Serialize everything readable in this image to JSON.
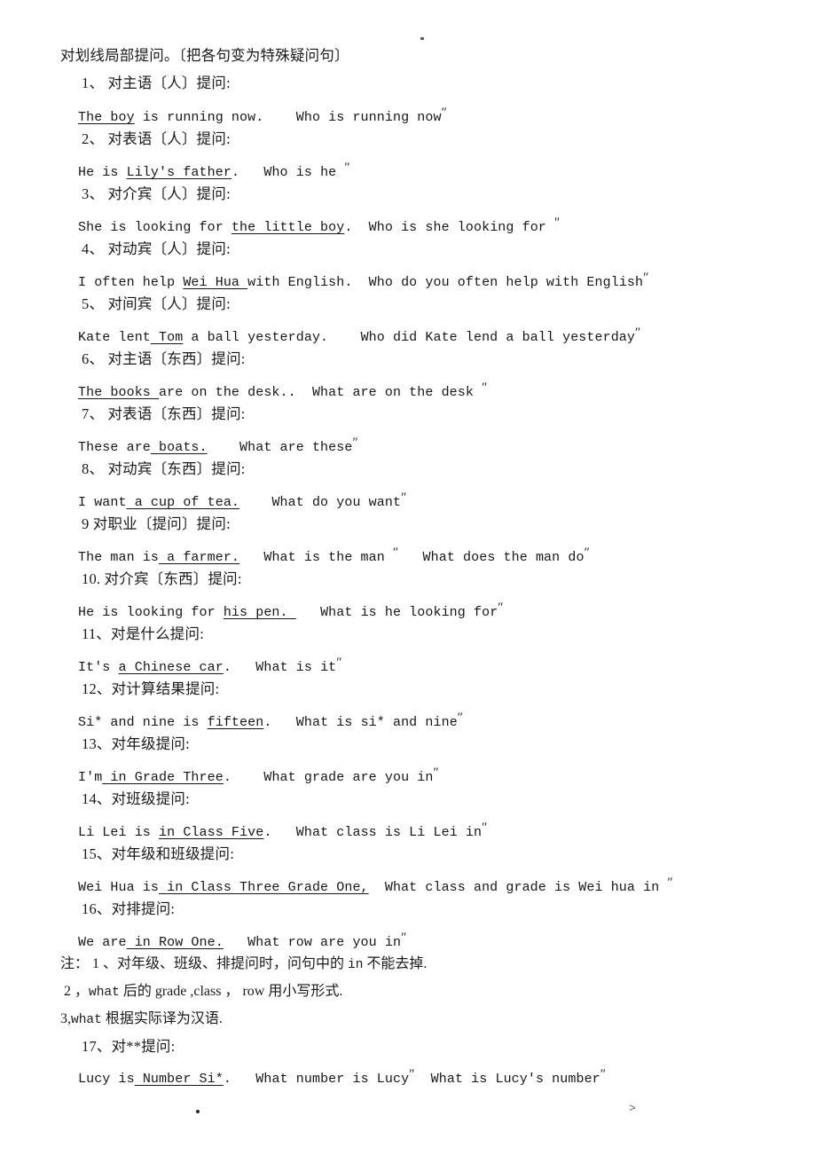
{
  "document": {
    "title": "对划线局部提问。〔把各句变为特殊疑问句〕",
    "page_marks": {
      "header_mark": "·",
      "footer_dot": "·",
      "footer_glyph": ">"
    }
  },
  "heading": {
    "text": "对划线局部提问。〔把各句变为特殊疑问句〕"
  },
  "items": [
    {
      "number": "1、",
      "label": "1、 对主语〔人〕提问:",
      "statement_pre": "",
      "statement_underlined": "The boy",
      "statement_post": " is running now.",
      "spacer": "    ",
      "question": "Who is running now",
      "qmark": "″"
    },
    {
      "number": "2、",
      "label": "2、 对表语〔人〕提问:",
      "statement_pre": "He is ",
      "statement_underlined": "Lily's father",
      "statement_post": ".",
      "spacer": "   ",
      "question": "Who is he ",
      "qmark": "″"
    },
    {
      "number": "3、",
      "label": "3、 对介宾〔人〕提问:",
      "statement_pre": "She is looking for ",
      "statement_underlined": "the little boy",
      "statement_post": ".",
      "spacer": "  ",
      "question": "Who is she looking for ",
      "qmark": "″"
    },
    {
      "number": "4、",
      "label": "4、 对动宾〔人〕提问:",
      "statement_pre": "I often help ",
      "statement_underlined": "Wei Hua ",
      "statement_post": "with English.",
      "spacer": "  ",
      "question": "Who do you often help with English",
      "qmark": "″"
    },
    {
      "number": "5、",
      "label": "5、 对间宾〔人〕提问:",
      "statement_pre": "Kate lent",
      "statement_underlined": " Tom",
      "statement_post": " a ball yesterday.",
      "spacer": "    ",
      "question": "Who did Kate lend a ball yesterday",
      "qmark": "″"
    },
    {
      "number": "6、",
      "label": "6、 对主语〔东西〕提问:",
      "statement_pre": "",
      "statement_underlined": "The books ",
      "statement_post": "are on the desk..",
      "spacer": "  ",
      "question": "What are on the desk ",
      "qmark": "″"
    },
    {
      "number": "7、",
      "label": "7、 对表语〔东西〕提问:",
      "statement_pre": "These are",
      "statement_underlined": " boats.",
      "statement_post": "",
      "spacer": "    ",
      "question": "What are these",
      "qmark": "″"
    },
    {
      "number": "8、",
      "label": "8、 对动宾〔东西〕提问:",
      "statement_pre": "I want",
      "statement_underlined": " a cup of tea.",
      "statement_post": "",
      "spacer": "    ",
      "question": "What do you want",
      "qmark": "″"
    },
    {
      "number": "9",
      "label": "9 对职业〔提问〕提问:",
      "statement_pre": "The man is",
      "statement_underlined": " a farmer.",
      "statement_post": "",
      "spacer": "   ",
      "question": "What is the man ",
      "qmark": "″",
      "question2": "What does the man do",
      "qmark2": "″",
      "spacer2": "   "
    },
    {
      "number": "10.",
      "label": "10. 对介宾〔东西〕提问:",
      "statement_pre": "He is looking for ",
      "statement_underlined": "his pen. ",
      "statement_post": "",
      "spacer": "   ",
      "question": "What is he looking for",
      "qmark": "″"
    },
    {
      "number": "11、",
      "label": "11、对是什么提问:",
      "statement_pre": "It's ",
      "statement_underlined": "a Chinese car",
      "statement_post": ".",
      "spacer": "   ",
      "question": "What is it",
      "qmark": "″"
    },
    {
      "number": "12、",
      "label": "12、对计算结果提问:",
      "statement_pre": "Si* and nine is ",
      "statement_underlined": "fifteen",
      "statement_post": ".",
      "spacer": "   ",
      "question": "What is si* and nine",
      "qmark": "″"
    },
    {
      "number": "13、",
      "label": "13、对年级提问:",
      "statement_pre": "I'm",
      "statement_underlined": " in Grade Three",
      "statement_post": ".",
      "spacer": "    ",
      "question": "What grade are you in",
      "qmark": "″"
    },
    {
      "number": "14、",
      "label": "14、对班级提问:",
      "statement_pre": "Li Lei is ",
      "statement_underlined": "in Class Five",
      "statement_post": ".",
      "spacer": "   ",
      "question": "What class is Li Lei in",
      "qmark": "″"
    },
    {
      "number": "15、",
      "label": "15、对年级和班级提问:",
      "statement_pre": "Wei Hua is",
      "statement_underlined": " in Class Three Grade One,",
      "statement_post": "",
      "spacer": "  ",
      "question": "What class and grade is Wei hua in ",
      "qmark": "″"
    },
    {
      "number": "16、",
      "label": "16、对排提问:",
      "statement_pre": "We are",
      "statement_underlined": " in Row One.",
      "statement_post": "",
      "spacer": "   ",
      "question": "What row are you in",
      "qmark": "″"
    }
  ],
  "notes": [
    {
      "text_a": "注： 1 、对年级、班级、排提问时，问句中的 ",
      "mono": "in",
      "text_b": " 不能去掉."
    },
    {
      "text_a": " 2 ，",
      "mono": "what",
      "text_b": " 后的 grade ,class ， row 用小写形式."
    },
    {
      "text_a": "3,",
      "mono": "what",
      "text_b": " 根据实际译为汉语."
    }
  ],
  "last_item": {
    "label": "17、对**提问:",
    "statement_pre": "Lucy is",
    "statement_underlined": " Number Si*",
    "statement_post": ".",
    "spacer": "   ",
    "question": "What number is Lucy",
    "qmark": "″",
    "spacer2": "  ",
    "question2": "What is Lucy's number",
    "qmark2": "″"
  }
}
